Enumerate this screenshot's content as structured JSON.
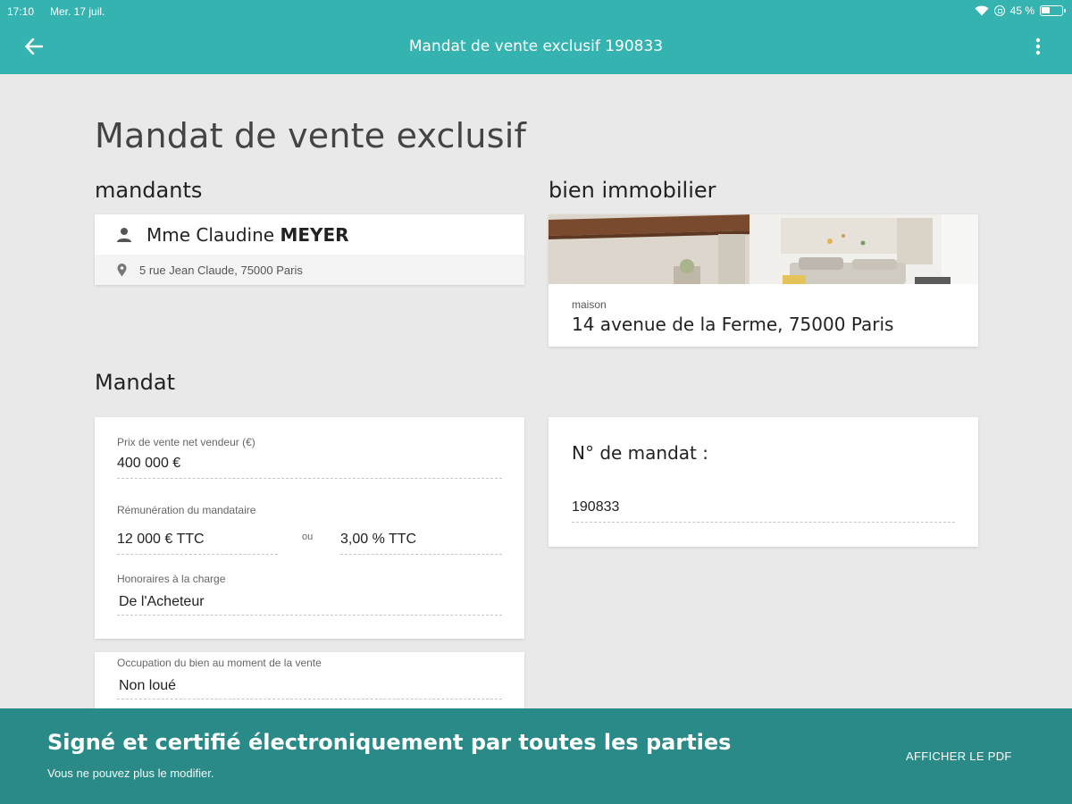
{
  "status_bar": {
    "time": "17:10",
    "date": "Mer. 17 juil.",
    "battery": "45 %",
    "battery_level": 0.45
  },
  "app_bar": {
    "title": "Mandat de vente exclusif 190833",
    "back_icon": "arrow-left-icon",
    "menu_icon": "more-vert-icon"
  },
  "page": {
    "title": "Mandat de vente exclusif"
  },
  "mandants": {
    "section_title": "mandants",
    "person_icon": "person-icon",
    "name_prefix": "Mme Claudine",
    "name_last": "MEYER",
    "location_icon": "location-pin-icon",
    "address": "5 rue Jean Claude, 75000 Paris"
  },
  "bien": {
    "section_title": "bien immobilier",
    "type": "maison",
    "address": "14 avenue de la Ferme, 75000 Paris"
  },
  "mandat": {
    "section_title": "Mandat",
    "prix_label": "Prix de vente net vendeur (€)",
    "prix_value": "400 000 €",
    "remuneration_label": "Rémunération du mandataire",
    "remuneration_amount": "12 000 € TTC",
    "ou": "ou",
    "remuneration_percent": "3,00 % TTC",
    "honoraires_label": "Honoraires à la charge",
    "honoraires_value": "De l'Acheteur",
    "occupation_label": "Occupation du bien au moment de la vente",
    "occupation_value": "Non loué"
  },
  "numero": {
    "label": "N° de mandat :",
    "value": "190833"
  },
  "banner": {
    "title": "Signé et certifié électroniquement par toutes les parties",
    "subtitle": "Vous ne pouvez plus le modifier.",
    "pdf_button": "AFFICHER LE PDF"
  },
  "colors": {
    "app_bar": "#34b3b0",
    "banner": "#2a8a87",
    "background": "#e9e9e9"
  }
}
